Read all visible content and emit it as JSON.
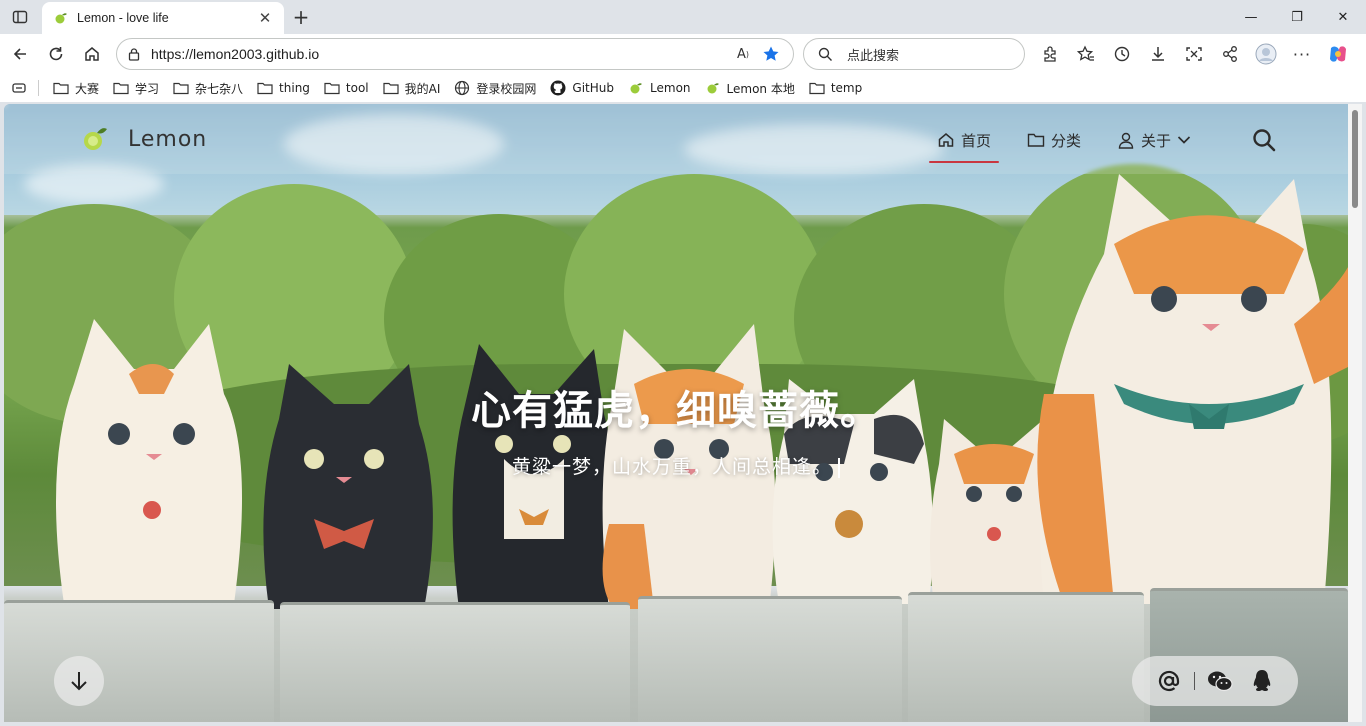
{
  "browser": {
    "tab": {
      "title": "Lemon - love life",
      "favicon": "lemon-favicon"
    },
    "address": {
      "url": "https://lemon2003.github.io"
    },
    "search": {
      "placeholder": "点此搜索"
    },
    "bookmarks": [
      {
        "label": "大赛",
        "icon": "folder-icon"
      },
      {
        "label": "学习",
        "icon": "folder-icon"
      },
      {
        "label": "杂七杂八",
        "icon": "folder-icon"
      },
      {
        "label": "thing",
        "icon": "folder-icon"
      },
      {
        "label": "tool",
        "icon": "folder-icon"
      },
      {
        "label": "我的AI",
        "icon": "folder-icon"
      },
      {
        "label": "登录校园网",
        "icon": "globe-icon"
      },
      {
        "label": "GitHub",
        "icon": "github-icon"
      },
      {
        "label": "Lemon",
        "icon": "lemon-icon"
      },
      {
        "label": "Lemon 本地",
        "icon": "lemon-icon"
      },
      {
        "label": "temp",
        "icon": "folder-icon"
      }
    ]
  },
  "site": {
    "logo_text": "Lemon",
    "menu": [
      {
        "label": "首页",
        "icon": "home-icon",
        "active": true
      },
      {
        "label": "分类",
        "icon": "folder-icon",
        "active": false
      },
      {
        "label": "关于",
        "icon": "user-icon",
        "active": false
      }
    ],
    "hero": {
      "title": "心有猛虎，细嗅蔷薇。",
      "subtitle": "黄粱一梦，山水万重，人间总相逢。"
    }
  },
  "colors": {
    "accent": "#c93640",
    "star": "#1a73e8"
  }
}
